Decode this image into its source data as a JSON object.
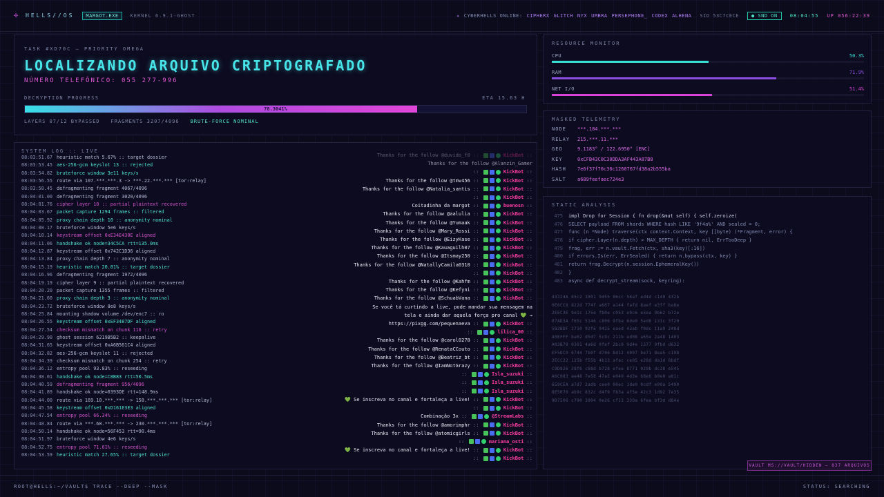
{
  "topbar": {
    "logo": "HELLS//OS",
    "process": "MARGOT.EXE",
    "kernel": "KERNEL 6.9.1-GHOST",
    "online_label": "CYBERHELLS ONLINE:",
    "handles": [
      "CIPHERX",
      "GLITCH",
      "NYX",
      "UMBRA",
      "PERSEPHONE_",
      "CODEX",
      "ALHENA"
    ],
    "sid": "SID 53C7CECE",
    "snd": "SND ON",
    "clock": "08:04:55",
    "uptime": "UP 056:22:39"
  },
  "task": {
    "subtitle": "TASK #XD70C — PRIORITY OMEGA",
    "title": "LOCALIZANDO ARQUIVO CRIPTOGRAFADO",
    "phone": "NÚMERO TELEFÔNICO: 055 277-996",
    "progress_label": "DECRYPTION PROGRESS",
    "eta": "ETA 15.63 H",
    "progress": 78.3,
    "progress_text": "78.3041%",
    "layers": "LAYERS 07/12 BYPASSED",
    "fragments": "FRAGMENTS 3207/4096",
    "bruteforce": "BRUTE-FORCE NOMINAL"
  },
  "resource": {
    "title": "RESOURCE MONITOR",
    "rows": [
      {
        "label": "CPU",
        "value": "50.3%",
        "level": 0.503,
        "color": "#37e0d6"
      },
      {
        "label": "RAM",
        "value": "71.9%",
        "level": 0.719,
        "color": "#8b4fe3"
      },
      {
        "label": "NET I/O",
        "value": "51.4%",
        "level": 0.514,
        "color": "#d844d6"
      }
    ]
  },
  "telemetry": {
    "title": "MASKED TELEMETRY",
    "rows": [
      {
        "k": "NODE",
        "v": "***.184.***.***"
      },
      {
        "k": "RELAY",
        "v": "215.***.11.***"
      },
      {
        "k": "GEO",
        "v": "9.1183° / 122.6950° [ENC]"
      },
      {
        "k": "KEY",
        "v": "0xCFB43C0C30DDA3AF443A87B8"
      },
      {
        "k": "HASH",
        "v": "7e6f37f70c36c1260767fd38a2b555ba"
      },
      {
        "k": "SALT",
        "v": "a689feefaec724e3"
      }
    ]
  },
  "analysis": {
    "title": "STATIC ANALYSIS",
    "code": [
      {
        "ln": "475",
        "tx": "impl Drop for Session { fn drop(&mut self) { self.zeroize(",
        "active": true
      },
      {
        "ln": "476",
        "tx": "SELECT payload FROM shards WHERE hash LIKE '9f4a%' AND sealed = 0;"
      },
      {
        "ln": "477",
        "tx": "func (n *Node) traverse(ctx context.Context, key []byte) (*Fragment, error) {"
      },
      {
        "ln": "478",
        "tx": "if cipher.Layer(n.depth) > MAX_DEPTH { return nil, ErrTooDeep }"
      },
      {
        "ln": "479",
        "tx": "frag, err := n.vault.Fetch(ctx, sha3(key)[:16])"
      },
      {
        "ln": "480",
        "tx": "if errors.Is(err, ErrSealed) { return n.bypass(ctx, key) }"
      },
      {
        "ln": "481",
        "tx": "return frag.Decrypt(n.session.EphemeralKey())"
      },
      {
        "ln": "482",
        "tx": "}"
      },
      {
        "ln": "483",
        "tx": "async def decrypt_stream(sock, keyring):"
      }
    ],
    "hex": [
      "43324A 65c2 3001 9d55 96cc 56af ed4d c140 432b",
      "0E6CC8 822d 774f a667 a144 fafd 8aef e3ff ba8e",
      "2EEC3E 9e1c 175e fb0e c053 e9c6 e5ea 9b62 b72e",
      "87AD3A f65c 5146 c806 9fba 6de0 5ed8 131c 3f20",
      "5B3BDF 2730 92f6 9425 eaed 43ab f0dc 11a9 248d",
      "A0EFFF ba02 d5d7 5c9c 212b ed08 a65e 2a48 1403",
      "A03B78 0301 4a6d 0fef 2bc0 9d4e 1377 9fbd d632",
      "EF5DC0 6744 7b0f d706 8d12 4097 be71 8ea5 c198",
      "2ECC22 125b f55b 4b13 afac ce05 e28d da1d 8bdf",
      "C9D826 38f6 c88d b728 efee 8771 029b dc28 e545",
      "A6C083 ae48 7e58 47a5 e049 4d3e 68e6 b9e0 a81c",
      "659CEA a7d7 2adb cee0 00ec 1de0 0cdf e09a 5490",
      "8E5070 ab9c 832c d4f9 f83a af5e 42c3 1d92 7e35",
      "9D7506 c790 3004 0e26 cf13 330a 6fea bf3d d84e"
    ]
  },
  "vault": "VAULT MS://VAULT/HIDDEN — 837 ARQUIVOS",
  "syslog": {
    "title": "SYSTEM LOG :: LIVE",
    "lines": [
      {
        "t": "08:03:51.67",
        "m": "heuristic match 5.67% :: target dossier",
        "c": ""
      },
      {
        "t": "08:03:53.45",
        "m": "aes-256-gcm keyslot 13 :: rejected",
        "c": "cyan"
      },
      {
        "t": "08:03:54.82",
        "m": "bruteforce window 3e11 keys/s",
        "c": "cyan"
      },
      {
        "t": "08:03:56.55",
        "m": "route via 107.***.***.3 -> ***.22.***.*** [tor:relay]",
        "c": ""
      },
      {
        "t": "08:03:58.45",
        "m": "defragmenting fragment 4067/4096",
        "c": ""
      },
      {
        "t": "08:04:01.00",
        "m": "defragmenting fragment 3020/4096",
        "c": ""
      },
      {
        "t": "08:04:01.76",
        "m": "cipher layer 10 :: partial plaintext recovered",
        "c": "pink"
      },
      {
        "t": "08:04:03.67",
        "m": "packet capture 1294 frames :: filtered",
        "c": "cyan"
      },
      {
        "t": "08:04:05.92",
        "m": "proxy chain depth 10 :: anonymity nominal",
        "c": "cyan"
      },
      {
        "t": "08:04:08.17",
        "m": "bruteforce window 5e6 keys/s",
        "c": ""
      },
      {
        "t": "08:04:10.14",
        "m": "keystream offset 0xE34E430E aligned",
        "c": "pink"
      },
      {
        "t": "08:04:11.06",
        "m": "handshake ok node=34C5CA rtt=135.0ms",
        "c": "cyan"
      },
      {
        "t": "08:04:12.87",
        "m": "keystream offset 0x742C1D36 aligned",
        "c": ""
      },
      {
        "t": "08:04:13.84",
        "m": "proxy chain depth 7 :: anonymity nominal",
        "c": ""
      },
      {
        "t": "08:04:15.19",
        "m": "heuristic match 20.81% :: target dossier",
        "c": "cyan"
      },
      {
        "t": "08:04:16.96",
        "m": "defragmenting fragment 1972/4096",
        "c": ""
      },
      {
        "t": "08:04:19.19",
        "m": "cipher layer 9 :: partial plaintext recovered",
        "c": ""
      },
      {
        "t": "08:04:20.20",
        "m": "packet capture 1355 frames :: filtered",
        "c": ""
      },
      {
        "t": "08:04:21.60",
        "m": "proxy chain depth 3 :: anonymity nominal",
        "c": "cyan"
      },
      {
        "t": "08:04:23.72",
        "m": "bruteforce window 8e8 keys/s",
        "c": ""
      },
      {
        "t": "08:04:25.84",
        "m": "mounting shadow volume /dev/enc7 :: ro",
        "c": ""
      },
      {
        "t": "08:04:26.55",
        "m": "keystream offset 0xEF3487DF aligned",
        "c": "cyan"
      },
      {
        "t": "08:04:27.54",
        "m": "checksum mismatch on chunk 116 :: retry",
        "c": "pink"
      },
      {
        "t": "08:04:29.90",
        "m": "ghost session 6219B5B2 :: keepalive",
        "c": ""
      },
      {
        "t": "08:04:31.65",
        "m": "keystream offset 0xA6B561C4 aligned",
        "c": ""
      },
      {
        "t": "08:04:32.82",
        "m": "aes-256-gcm keyslot 11 :: rejected",
        "c": ""
      },
      {
        "t": "08:04:34.39",
        "m": "checksum mismatch on chunk 254 :: retry",
        "c": ""
      },
      {
        "t": "08:04:36.12",
        "m": "entropy pool 93.83% :: reseeding",
        "c": ""
      },
      {
        "t": "08:04:38.01",
        "m": "handshake ok node=C8B83 rtt=50.5ms",
        "c": "cyan"
      },
      {
        "t": "08:04:40.59",
        "m": "defragmenting fragment 956/4096",
        "c": "pink"
      },
      {
        "t": "08:04:41.89",
        "m": "handshake ok node=0393DE rtt=148.9ms",
        "c": ""
      },
      {
        "t": "08:04:44.00",
        "m": "route via 169.10.***.*** -> 158.***.***.*** [tor:relay]",
        "c": ""
      },
      {
        "t": "08:04:45.58",
        "m": "keystream offset 0xD161E3E3 aligned",
        "c": "cyan"
      },
      {
        "t": "08:04:47.54",
        "m": "entropy pool 66.34% :: reseeding",
        "c": "pink"
      },
      {
        "t": "08:04:48.84",
        "m": "route via ***.68.***.*** -> 230.***.***.*** [tor:relay]",
        "c": ""
      },
      {
        "t": "08:04:50.14",
        "m": "handshake ok node=56F453 rtt=90.4ms",
        "c": ""
      },
      {
        "t": "08:04:51.97",
        "m": "bruteforce window 4e6 keys/s",
        "c": ""
      },
      {
        "t": "08:04:52.75",
        "m": "entropy pool 71.61% :: reseeding",
        "c": "pink"
      },
      {
        "t": "08:04:53.59",
        "m": "heuristic match 27.65% :: target dossier",
        "c": "cyan"
      }
    ]
  },
  "chat": [
    {
      "msg": "Thanks for the follow @duvido_f0",
      "user": "KickBot",
      "style": "faded"
    },
    {
      "msg": "Thanks for the follow @Alanzin_Gamer",
      "user": "",
      "style": "faded2"
    },
    {
      "msg": "",
      "user": "KickBot",
      "style": ""
    },
    {
      "msg": "Thanks for the follow @tmv456",
      "user": "KickBot",
      "style": ""
    },
    {
      "msg": "Thanks for the follow @Natalia_santis",
      "user": "KickBot",
      "style": ""
    },
    {
      "msg": "",
      "user": "KickBot",
      "style": ""
    },
    {
      "msg": "Coitadinha da margot",
      "user": "buenosn",
      "style": ""
    },
    {
      "msg": "Thanks for the follow @aalulia",
      "user": "KickBot",
      "style": ""
    },
    {
      "msg": "Thanks for the follow @Yumaak",
      "user": "KickBot",
      "style": ""
    },
    {
      "msg": "Thanks for the follow @Mary_Rossi",
      "user": "KickBot",
      "style": ""
    },
    {
      "msg": "Thanks for the follow @EizyKase",
      "user": "KickBot",
      "style": ""
    },
    {
      "msg": "Thanks for the follow @Kauaguilh07",
      "user": "KickBot",
      "style": ""
    },
    {
      "msg": "Thanks for the follow @Itsmay250",
      "user": "KickBot",
      "style": ""
    },
    {
      "msg": "Thanks for the follow @NatallyCamila0310",
      "user": "KickBot",
      "style": ""
    },
    {
      "msg": "",
      "user": "KickBot",
      "style": ""
    },
    {
      "msg": "Thanks for the follow @Kahfm",
      "user": "KickBot",
      "style": ""
    },
    {
      "msg": "Thanks for the follow @Kefyni",
      "user": "KickBot",
      "style": ""
    },
    {
      "msg": "Thanks for the follow @SchuabVana",
      "user": "KickBot",
      "style": ""
    },
    {
      "msg": "Se você tá curtindo a live, pode mandar sua mensagem na",
      "user": "",
      "style": ""
    },
    {
      "msg": "tela e ainda dar aquela força pro canal 💚 →",
      "user": "",
      "style": ""
    },
    {
      "msg": "https://pixgg.com/pequenaeva",
      "user": "KickBot",
      "style": ""
    },
    {
      "msg": "",
      "user": "lilica_00",
      "style": ""
    },
    {
      "msg": "Thanks for the follow @carol0278",
      "user": "KickBot",
      "style": ""
    },
    {
      "msg": "Thanks for the follow @RenataCCouto",
      "user": "KickBot",
      "style": ""
    },
    {
      "msg": "Thanks for the follow @Beatriz_bt",
      "user": "KickBot",
      "style": ""
    },
    {
      "msg": "Thanks for the follow @IamNotGrazy",
      "user": "KickBot",
      "style": ""
    },
    {
      "msg": "",
      "user": "Isla_suzuki",
      "style": ""
    },
    {
      "msg": "",
      "user": "Isla_suzuki",
      "style": ""
    },
    {
      "msg": "",
      "user": "Isla_suzuki",
      "style": ""
    },
    {
      "msg": "💚 Se inscreva no canal e fortaleça a live!",
      "user": "KickBot",
      "style": ""
    },
    {
      "msg": "",
      "user": "KickBot",
      "style": ""
    },
    {
      "msg": "Combinação 3x",
      "user": "@StreamLabs",
      "style": ""
    },
    {
      "msg": "Thanks for the follow @amorimphr",
      "user": "KickBot",
      "style": ""
    },
    {
      "msg": "Thanks for the follow @atomicgirls",
      "user": "KickBot",
      "style": ""
    },
    {
      "msg": "",
      "user": "mariana_osti",
      "style": ""
    },
    {
      "msg": "💚 Se inscreva no canal e fortaleça a live!",
      "user": "KickBot",
      "style": ""
    },
    {
      "msg": "",
      "user": "KickBot",
      "style": ""
    }
  ],
  "bottombar": {
    "cmd": "ROOT@HELLS:~/VAULT$ TRACE --DEEP --MASK",
    "status": "STATUS: SEARCHING"
  }
}
